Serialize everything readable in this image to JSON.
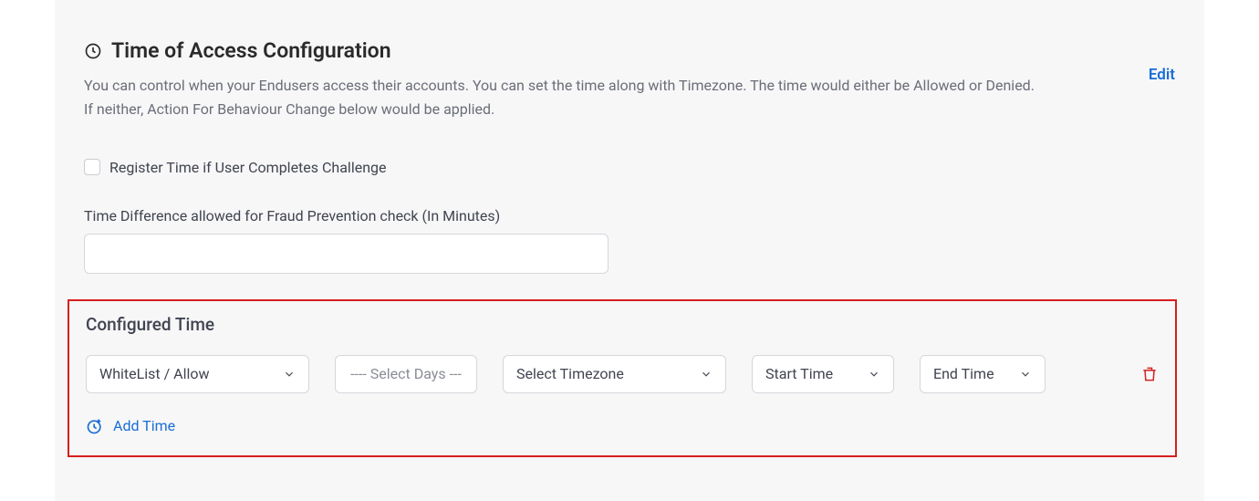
{
  "header": {
    "title": "Time of Access Configuration",
    "description": "You can control when your Endusers access their accounts. You can set the time along with Timezone. The time would either be Allowed or Denied. If neither, Action For Behaviour Change below would be applied.",
    "edit_label": "Edit"
  },
  "checkbox": {
    "label": "Register Time if User Completes Challenge",
    "checked": false
  },
  "time_diff": {
    "label": "Time Difference allowed for Fraud Prevention check (In Minutes)",
    "value": ""
  },
  "configured": {
    "title": "Configured Time",
    "row": {
      "whitelist_label": "WhiteList / Allow",
      "days_placeholder": "---- Select Days ---",
      "timezone_label": "Select Timezone",
      "start_label": "Start Time",
      "end_label": "End Time"
    },
    "add_time_label": "Add Time"
  }
}
